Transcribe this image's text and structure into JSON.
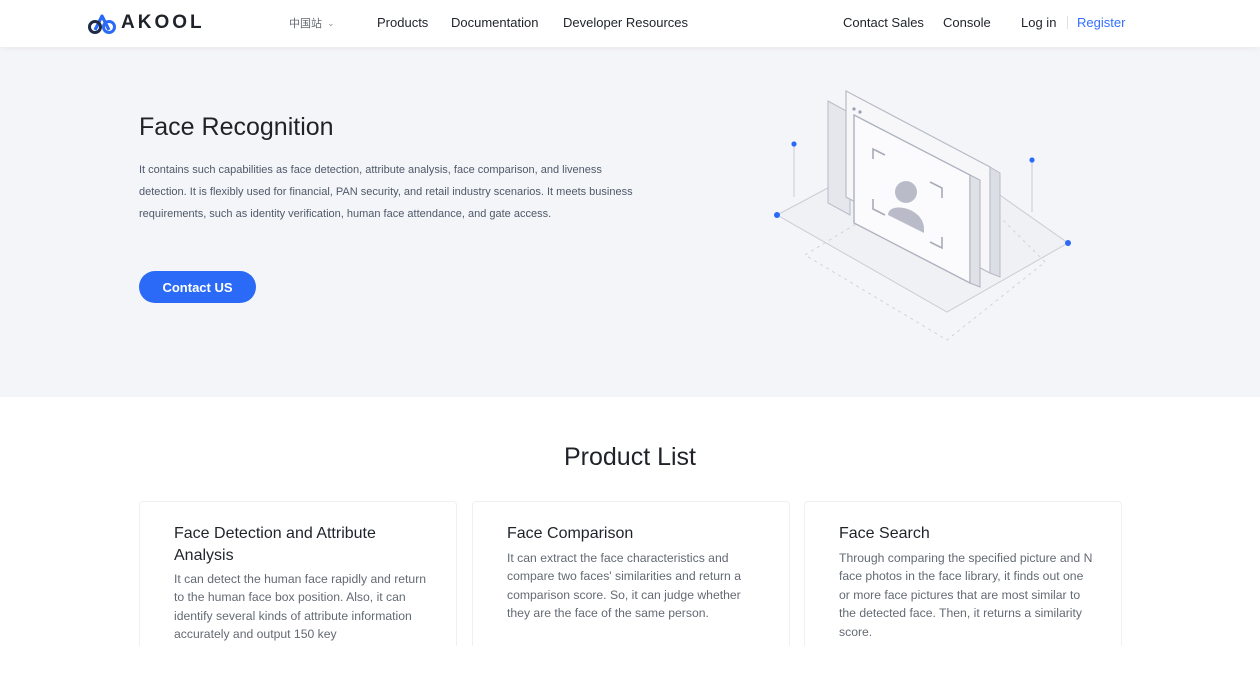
{
  "header": {
    "logo_text": "AKOOL",
    "region": "中国站",
    "nav": {
      "products": "Products",
      "documentation": "Documentation",
      "developer_resources": "Developer Resources",
      "contact_sales": "Contact Sales",
      "console": "Console",
      "login": "Log in",
      "register": "Register"
    },
    "accent_color": "#3370ff"
  },
  "hero": {
    "title": "Face Recognition",
    "description": "It contains such capabilities as face detection, attribute analysis, face comparison, and liveness detection. It is flexibly used for financial, PAN security, and retail industry scenarios. It meets business requirements, such as identity verification, human face attendance, and gate access.",
    "cta_label": "Contact US",
    "cta_color": "#2b6af7",
    "illustration": "face-recognition-illustration"
  },
  "product_list": {
    "title": "Product List",
    "cards": [
      {
        "title": "Face Detection and Attribute Analysis",
        "description": "It can detect the human face rapidly and return to the human face box position. Also, it can identify several kinds of attribute information accurately and output 150 key"
      },
      {
        "title": "Face Comparison",
        "description": "It can extract the face characteristics and compare two faces' similarities and return a comparison score. So, it can judge whether they are the face of the same person."
      },
      {
        "title": "Face Search",
        "description": "Through comparing the specified picture and N face photos in the face library, it finds out one or more face pictures that are most similar to the detected face. Then, it returns a similarity score."
      }
    ]
  }
}
